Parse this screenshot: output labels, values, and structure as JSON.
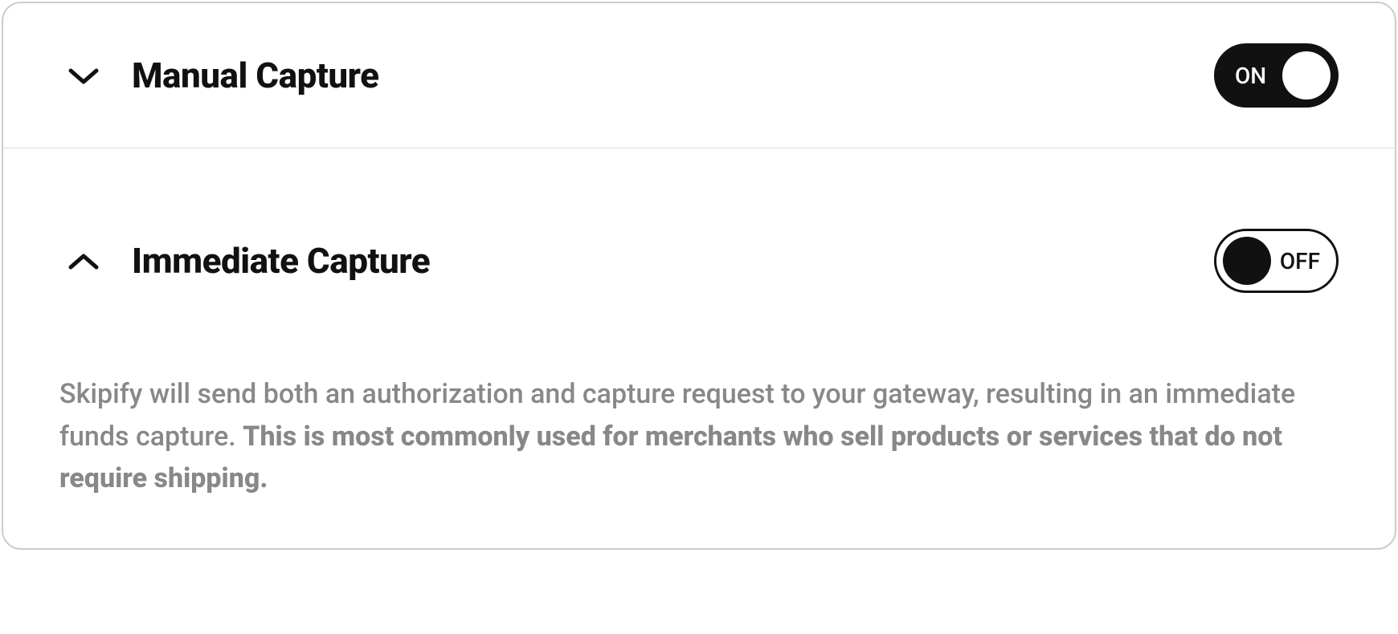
{
  "sections": {
    "manual_capture": {
      "title": "Manual Capture",
      "toggle_state": "on",
      "toggle_label": "ON",
      "expanded": false
    },
    "immediate_capture": {
      "title": "Immediate Capture",
      "toggle_state": "off",
      "toggle_label": "OFF",
      "expanded": true,
      "description_normal": "Skipify will send both an authorization and capture request to your gateway, resulting in an immediate funds capture. ",
      "description_bold": "This is most commonly used for merchants who sell products or services that do not require shipping."
    }
  }
}
